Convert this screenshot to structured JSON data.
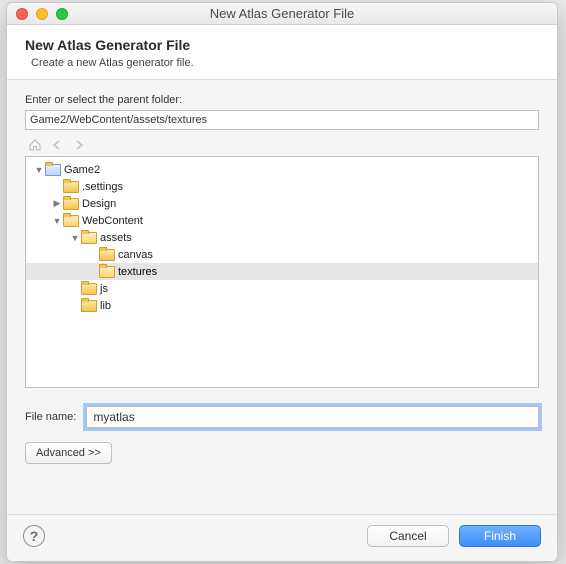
{
  "window": {
    "title": "New Atlas Generator File"
  },
  "header": {
    "title": "New Atlas Generator File",
    "subtitle": "Create a new Atlas generator file."
  },
  "parentFolder": {
    "label": "Enter or select the parent folder:",
    "value": "Game2/WebContent/assets/textures"
  },
  "tree": [
    {
      "depth": 0,
      "expand": "open",
      "icon": "project",
      "label": "Game2",
      "selected": false
    },
    {
      "depth": 1,
      "expand": "none",
      "icon": "closed",
      "label": ".settings",
      "selected": false
    },
    {
      "depth": 1,
      "expand": "closed",
      "icon": "closed",
      "label": "Design",
      "selected": false
    },
    {
      "depth": 1,
      "expand": "open",
      "icon": "open",
      "label": "WebContent",
      "selected": false
    },
    {
      "depth": 2,
      "expand": "open",
      "icon": "open",
      "label": "assets",
      "selected": false
    },
    {
      "depth": 3,
      "expand": "none",
      "icon": "closed",
      "label": "canvas",
      "selected": false
    },
    {
      "depth": 3,
      "expand": "none",
      "icon": "open",
      "label": "textures",
      "selected": true
    },
    {
      "depth": 2,
      "expand": "none",
      "icon": "closed",
      "label": "js",
      "selected": false
    },
    {
      "depth": 2,
      "expand": "none",
      "icon": "closed",
      "label": "lib",
      "selected": false
    }
  ],
  "fileName": {
    "label": "File name:",
    "value": "myatlas"
  },
  "advanced": {
    "label": "Advanced >>"
  },
  "footer": {
    "cancel": "Cancel",
    "finish": "Finish"
  }
}
